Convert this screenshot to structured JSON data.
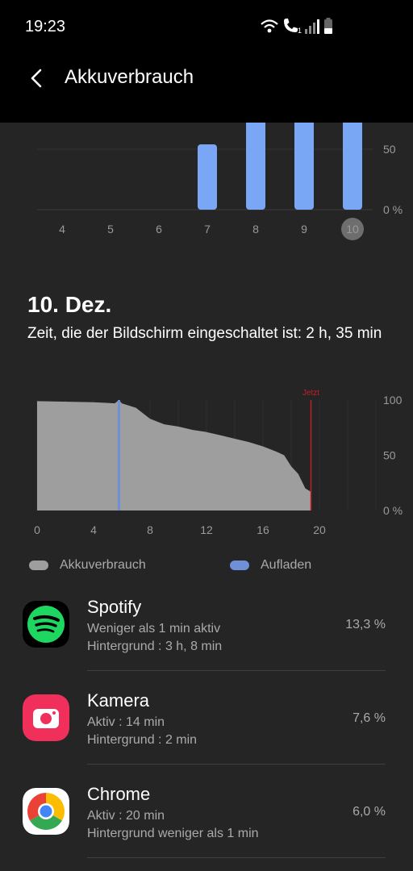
{
  "status_bar": {
    "time": "19:23"
  },
  "app_bar": {
    "title": "Akkuverbrauch"
  },
  "weekly_chart": {
    "y_ticks": [
      "50",
      "0 %"
    ],
    "days": [
      "4",
      "5",
      "6",
      "7",
      "8",
      "9",
      "10"
    ],
    "selected_day": "10"
  },
  "day": {
    "date": "10. Dez.",
    "screen_time": "Zeit, die der Bildschirm eingeschaltet ist: 2 h, 35 min"
  },
  "legend": {
    "usage": "Akkuverbrauch",
    "charging": "Aufladen"
  },
  "apps": [
    {
      "name": "Spotify",
      "line1": "Weniger als 1 min aktiv",
      "line2": "Hintergrund : 3 h, 8 min",
      "percent": "13,3 %",
      "icon": "spotify-icon"
    },
    {
      "name": "Kamera",
      "line1": "Aktiv : 14 min",
      "line2": "Hintergrund : 2 min",
      "percent": "7,6 %",
      "icon": "camera-icon"
    },
    {
      "name": "Chrome",
      "line1": "Aktiv : 20 min",
      "line2": "Hintergrund weniger als 1 min",
      "percent": "6,0 %",
      "icon": "chrome-icon"
    }
  ],
  "colors": {
    "bar": "#7aa6f6",
    "charging": "#6f8fd6",
    "usage_fill": "#9e9e9e",
    "now_line": "#c0202a"
  },
  "chart_data": [
    {
      "type": "bar",
      "categories": [
        "4",
        "5",
        "6",
        "7",
        "8",
        "9",
        "10"
      ],
      "values": [
        0,
        0,
        0,
        54,
        100,
        100,
        100
      ],
      "ylim": [
        0,
        100
      ],
      "y_ticks": [
        "50",
        "0 %"
      ]
    },
    {
      "type": "area",
      "x": [
        0,
        4,
        5.5,
        5.8,
        6,
        7,
        8,
        9,
        10,
        11,
        12,
        13,
        14,
        15,
        16,
        17,
        17.5,
        18,
        18.5,
        19,
        19.4
      ],
      "y": [
        99,
        98,
        97,
        100,
        97,
        93,
        83,
        78,
        76,
        73,
        71,
        68,
        65,
        62,
        58,
        53,
        50,
        40,
        33,
        20,
        17
      ],
      "series": [
        {
          "name": "Akkuverbrauch"
        },
        {
          "name": "Aufladen"
        }
      ],
      "charging_x": 5.8,
      "now_x": 19.4,
      "now_label": "Jetzt",
      "x_ticks": [
        "0",
        "4",
        "8",
        "12",
        "16",
        "20"
      ],
      "y_ticks": [
        "100",
        "50",
        "0 %"
      ],
      "xlim": [
        0,
        24
      ],
      "ylim": [
        0,
        100
      ]
    }
  ]
}
